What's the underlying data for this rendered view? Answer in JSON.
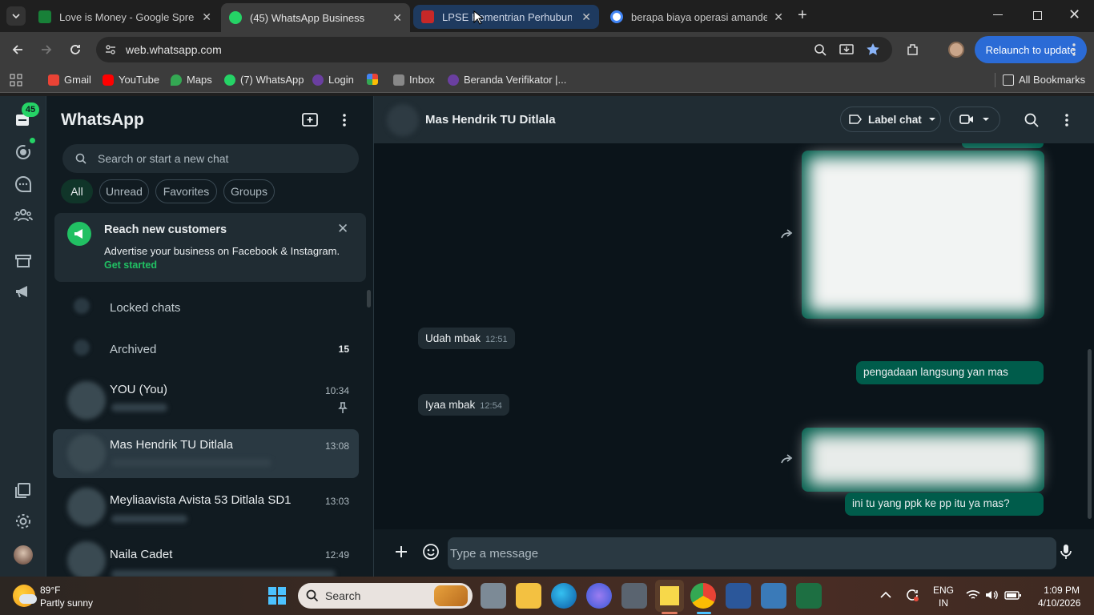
{
  "browser": {
    "tabs": [
      {
        "label": "Love is Money - Google Spreadsheet",
        "icon": "sheets-icon"
      },
      {
        "label": "(45) WhatsApp Business",
        "icon": "whatsapp-icon",
        "active": true
      },
      {
        "label": "LPSE Kementrian Perhubungan",
        "icon": "lpse-icon"
      },
      {
        "label": "berapa biaya operasi amandel - Google",
        "icon": "google-icon"
      }
    ],
    "url": "web.whatsapp.com",
    "relaunch_label": "Relaunch to update",
    "bookmarks": [
      "Gmail",
      "YouTube",
      "Maps",
      "(7) WhatsApp",
      "Login",
      "",
      "Inbox",
      "Beranda Verifikator |..."
    ],
    "all_bookmarks_label": "All Bookmarks"
  },
  "rail": {
    "badge": "45"
  },
  "sidebar": {
    "title": "WhatsApp",
    "search_placeholder": "Search or start a new chat",
    "filters": [
      "All",
      "Unread",
      "Favorites",
      "Groups"
    ],
    "promo": {
      "title": "Reach new customers",
      "body": "Advertise your business on Facebook & Instagram.",
      "cta": "Get started"
    },
    "locked_label": "Locked chats",
    "archived_label": "Archived",
    "archived_count": "15",
    "chats": [
      {
        "name": "YOU (You)",
        "time": "10:34",
        "pinned": true
      },
      {
        "name": "Mas Hendrik TU Ditlala",
        "time": "13:08",
        "selected": true
      },
      {
        "name": "Meyliaavista Avista 53 Ditlala SD1",
        "time": "13:03"
      },
      {
        "name": "Naila Cadet",
        "time": "12:49"
      }
    ]
  },
  "chat": {
    "contact": "Mas Hendrik TU Ditlala",
    "label_chat": "Label chat",
    "messages": [
      {
        "dir": "in",
        "text": "Udah mbak",
        "time": "12:51"
      },
      {
        "dir": "out",
        "text": "pengadaan langsung yan mas"
      },
      {
        "dir": "in",
        "text": "Iyaa mbak",
        "time": "12:54"
      },
      {
        "dir": "out",
        "text": "ini tu yang ppk ke pp itu ya mas?"
      }
    ],
    "input_placeholder": "Type a message"
  },
  "taskbar": {
    "weather_temp": "89°F",
    "weather_desc": "Partly sunny",
    "search_label": "Search",
    "lang_top": "ENG",
    "lang_bottom": "IN",
    "time": "1:09 PM",
    "date": "4/10/2026"
  }
}
